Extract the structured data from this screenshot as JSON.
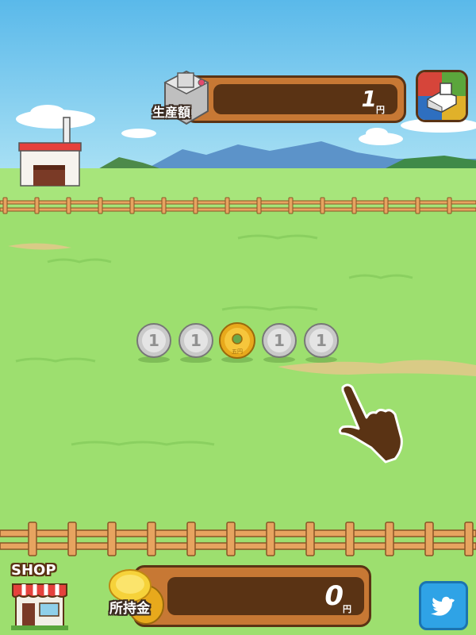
{
  "header": {
    "production_label": "生産額",
    "production_value": "1",
    "production_unit": "円"
  },
  "footer": {
    "shop_label": "SHOP",
    "money_label": "所持金",
    "money_value": "0",
    "money_unit": "円"
  },
  "coins": [
    {
      "type": "one-yen",
      "text": "1"
    },
    {
      "type": "one-yen",
      "text": "1"
    },
    {
      "type": "five-yen",
      "text": "五円"
    },
    {
      "type": "one-yen",
      "text": "1"
    },
    {
      "type": "one-yen",
      "text": "1"
    }
  ],
  "colors": {
    "sky": "#72c6ec",
    "grass": "#9ddf6f",
    "panel": "#c77834",
    "panel_dark": "#5a3314",
    "twitter": "#2fa3e6"
  }
}
